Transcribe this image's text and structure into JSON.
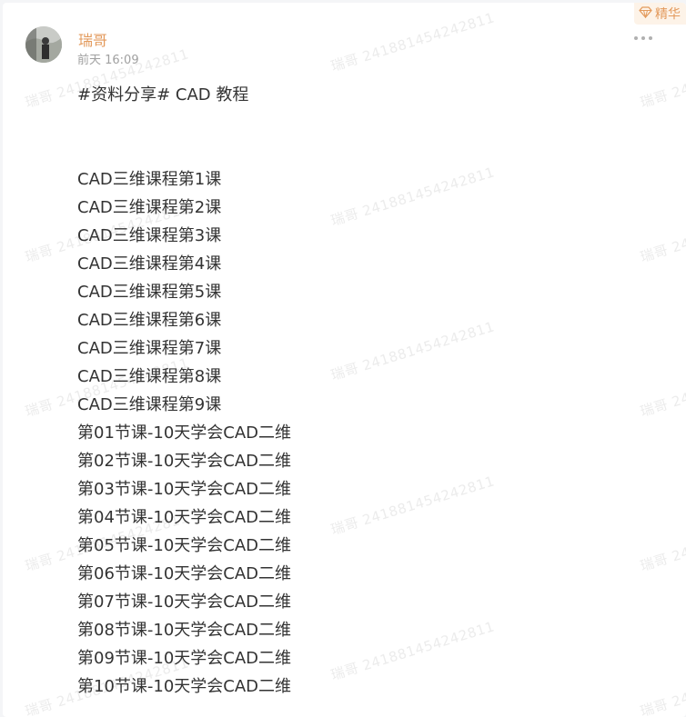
{
  "post": {
    "author": "瑞哥",
    "time": "前天 16:09",
    "badge_label": "精华",
    "title": "#资料分享# CAD 教程",
    "lines": [
      "CAD三维课程第1课",
      "CAD三维课程第2课",
      "CAD三维课程第3课",
      "CAD三维课程第4课",
      "CAD三维课程第5课",
      "CAD三维课程第6课",
      "CAD三维课程第7课",
      "CAD三维课程第8课",
      "CAD三维课程第9课",
      "第01节课-10天学会CAD二维",
      "第02节课-10天学会CAD二维",
      "第03节课-10天学会CAD二维",
      "第04节课-10天学会CAD二维",
      "第05节课-10天学会CAD二维",
      "第06节课-10天学会CAD二维",
      "第07节课-10天学会CAD二维",
      "第08节课-10天学会CAD二维",
      "第09节课-10天学会CAD二维",
      "第10节课-10天学会CAD二维"
    ]
  },
  "watermark": "瑞哥 241881454242811",
  "icons": {
    "badge": "diamond-icon",
    "more": "more-dots-icon"
  },
  "colors": {
    "accent": "#e39a5c",
    "text": "#333333",
    "muted": "#a0a0a0",
    "badge_bg": "#fdf3e8",
    "watermark": "#ececec"
  }
}
